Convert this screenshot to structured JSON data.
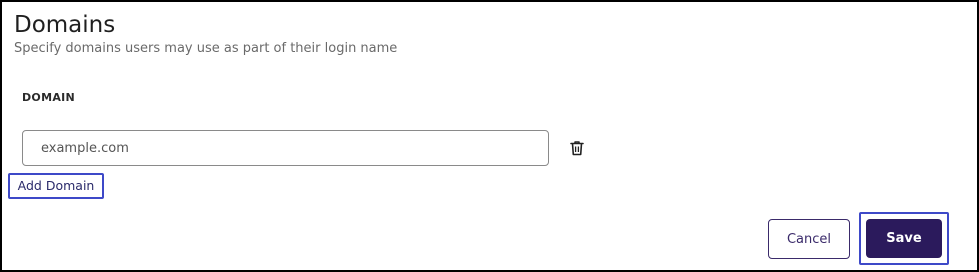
{
  "section": {
    "title": "Domains",
    "subtitle": "Specify domains users may use as part of their login name"
  },
  "domain_field": {
    "label": "DOMAIN",
    "value": "example.com",
    "delete_icon": "trash-icon"
  },
  "actions": {
    "add_domain_label": "Add Domain",
    "cancel_label": "Cancel",
    "save_label": "Save"
  },
  "colors": {
    "primary": "#2b1a5c",
    "highlight_outline": "#3e49c8"
  }
}
